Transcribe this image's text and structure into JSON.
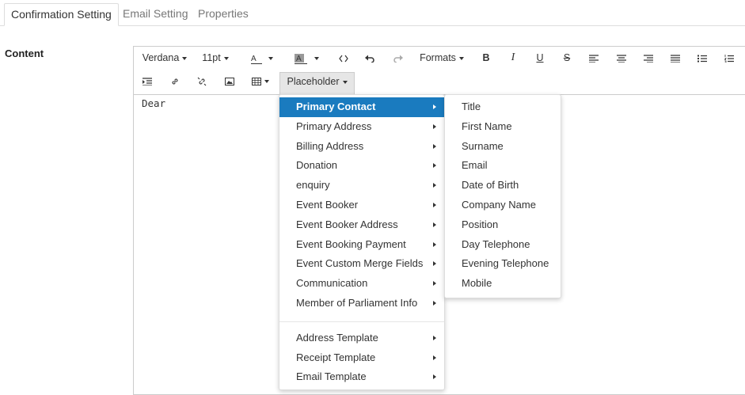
{
  "tabs": [
    {
      "label": "Confirmation Setting",
      "active": true
    },
    {
      "label": "Email Setting",
      "active": false
    },
    {
      "label": "Properties",
      "active": false
    }
  ],
  "content_label": "Content",
  "toolbar": {
    "font_family": "Verdana",
    "font_size": "11pt",
    "text_color_glyph": "A",
    "bg_color_glyph": "A",
    "formats_label": "Formats",
    "placeholder_label": "Placeholder"
  },
  "document": {
    "text": "Dear"
  },
  "placeholder_menu": {
    "items": [
      "Primary Contact",
      "Primary Address",
      "Billing Address",
      "Donation",
      "enquiry",
      "Event Booker",
      "Event Booker Address",
      "Event Booking Payment",
      "Event Custom Merge Fields",
      "Communication",
      "Member of Parliament Info"
    ],
    "templates": [
      "Address Template",
      "Receipt Template",
      "Email Template"
    ],
    "active_item": "Primary Contact"
  },
  "primary_contact_submenu": {
    "items": [
      "Title",
      "First Name",
      "Surname",
      "Email",
      "Date of Birth",
      "Company Name",
      "Position",
      "Day Telephone",
      "Evening Telephone",
      "Mobile"
    ]
  },
  "colors": {
    "accent": "#1a7bbf",
    "border": "#cccccc"
  }
}
